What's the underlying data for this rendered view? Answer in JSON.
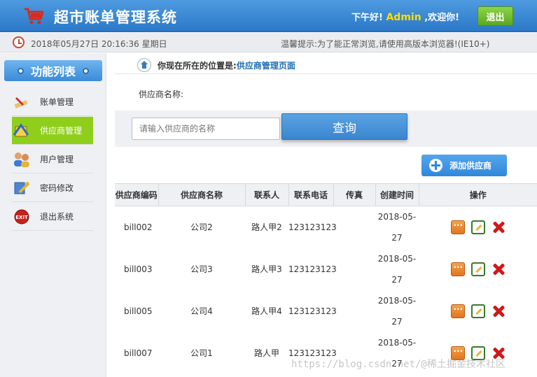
{
  "header": {
    "title": "超市账单管理系统",
    "greeting_prefix": "下午好!",
    "username": "Admin",
    "greeting_suffix": ",欢迎你!",
    "logout_label": "退出"
  },
  "timebar": {
    "datetime": "2018年05月27日 20:16:36 星期日",
    "tip": "温馨提示:为了能正常浏览,请使用高版本浏览器!(IE10+)"
  },
  "sidebar": {
    "title": "功能列表",
    "items": [
      {
        "label": "账单管理",
        "icon": "pencil-icon"
      },
      {
        "label": "供应商管理",
        "icon": "supplier-icon",
        "active": true
      },
      {
        "label": "用户管理",
        "icon": "users-icon"
      },
      {
        "label": "密码修改",
        "icon": "key-icon"
      },
      {
        "label": "退出系统",
        "icon": "exit-icon"
      }
    ]
  },
  "breadcrumb": {
    "prefix": "你现在所在的位置是:",
    "current": "供应商管理页面"
  },
  "search": {
    "label": "供应商名称:",
    "placeholder": "请输入供应商的名称",
    "button_label": "查询"
  },
  "add_button_label": "添加供应商",
  "table": {
    "headers": [
      "供应商编码",
      "供应商名称",
      "联系人",
      "联系电话",
      "传真",
      "创建时间",
      "操作"
    ],
    "rows": [
      {
        "code": "bill002",
        "name": "公司2",
        "contact": "路人甲2",
        "phone": "123123123",
        "fax": "",
        "date": "2018-05-27"
      },
      {
        "code": "bill003",
        "name": "公司3",
        "contact": "路人甲3",
        "phone": "123123123",
        "fax": "",
        "date": "2018-05-27"
      },
      {
        "code": "bill005",
        "name": "公司4",
        "contact": "路人甲4",
        "phone": "123123123",
        "fax": "",
        "date": "2018-05-27"
      },
      {
        "code": "bill007",
        "name": "公司1",
        "contact": "路人甲",
        "phone": "123123123",
        "fax": "",
        "date": "2018-05-27"
      }
    ]
  },
  "watermark": "https://blog.csdn.net/@稀土掘金技术社区",
  "colors": {
    "header_blue": "#2a78c8",
    "active_green": "#8fcf1b",
    "logout_green": "#5aa81f",
    "username_yellow": "#ffde00",
    "link_blue": "#1f6fb5"
  }
}
